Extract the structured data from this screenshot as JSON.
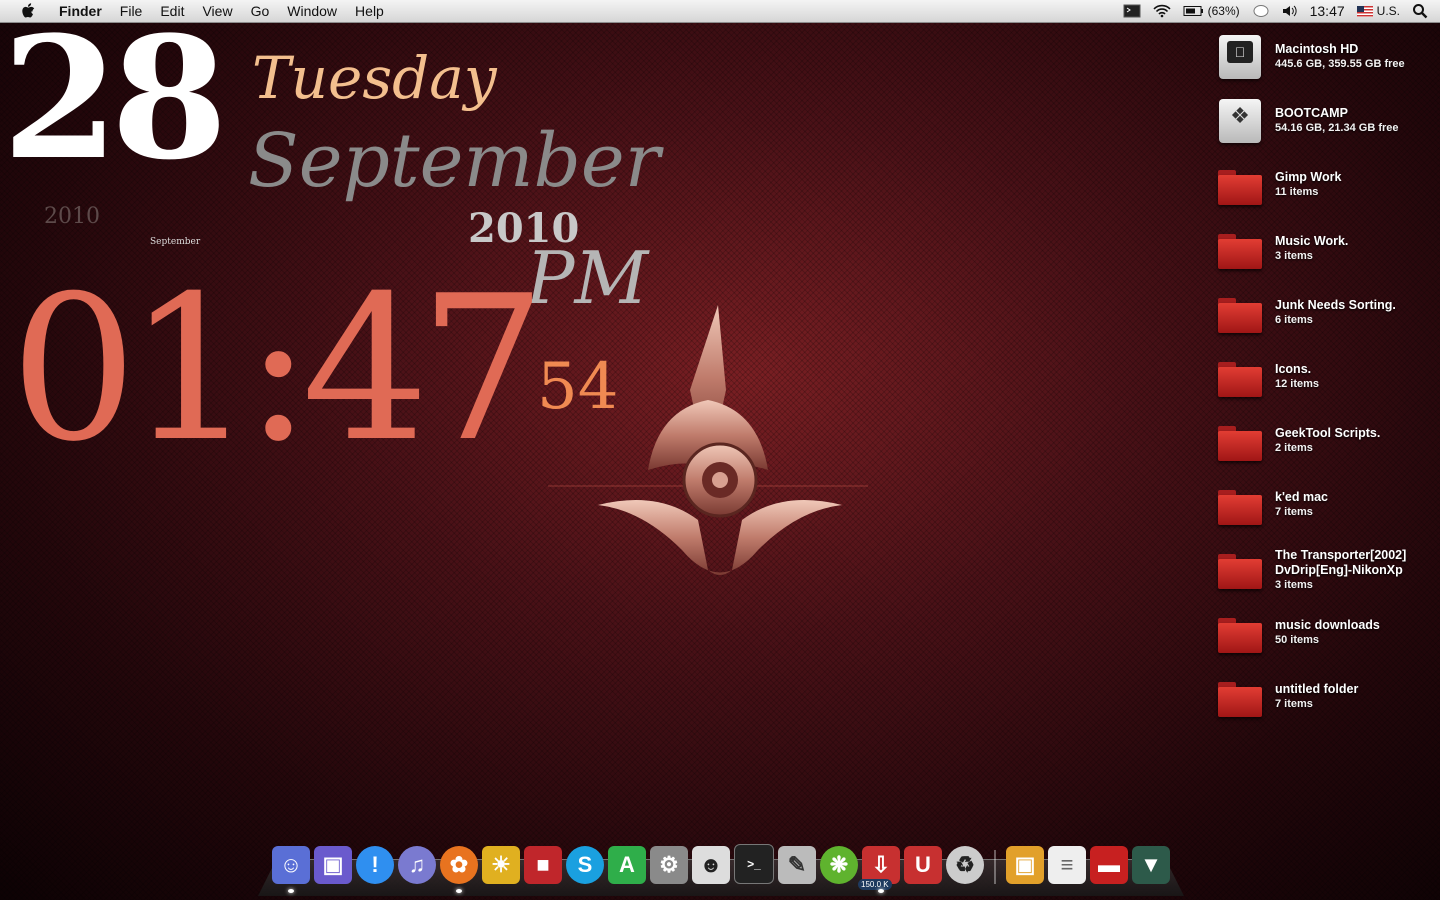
{
  "menubar": {
    "app": "Finder",
    "items": [
      "File",
      "Edit",
      "View",
      "Go",
      "Window",
      "Help"
    ],
    "battery": "(63%)",
    "clock": "13:47",
    "input_source": "U.S."
  },
  "clock_widget": {
    "day": "28",
    "weekday": "Tuesday",
    "month": "September",
    "year_small": "2010",
    "month_tiny": "September",
    "year": "2010",
    "ampm": "PM",
    "time": "01:47",
    "seconds": "54"
  },
  "desktop_icons": [
    {
      "name": "Macintosh HD",
      "sub": "445.6 GB, 359.55 GB free",
      "icon": "hard-drive-icon"
    },
    {
      "name": "BOOTCAMP",
      "sub": "54.16 GB, 21.34 GB free",
      "icon": "bootcamp-drive-icon"
    },
    {
      "name": "Gimp Work",
      "sub": "11 items",
      "icon": "folder-icon"
    },
    {
      "name": "Music Work.",
      "sub": "3 items",
      "icon": "folder-icon"
    },
    {
      "name": "Junk Needs Sorting.",
      "sub": "6 items",
      "icon": "folder-icon"
    },
    {
      "name": "Icons.",
      "sub": "12 items",
      "icon": "folder-icon"
    },
    {
      "name": "GeekTool Scripts.",
      "sub": "2 items",
      "icon": "folder-icon"
    },
    {
      "name": "k'ed mac",
      "sub": "7 items",
      "icon": "folder-icon"
    },
    {
      "name": "The Transporter[2002]\nDvDrip[Eng]-NikonXp",
      "sub": "3 items",
      "icon": "folder-icon"
    },
    {
      "name": "music downloads",
      "sub": "50 items",
      "icon": "folder-icon"
    },
    {
      "name": "untitled folder",
      "sub": "7 items",
      "icon": "folder-icon"
    }
  ],
  "dock": {
    "download_badge": "150.0 K",
    "apps": [
      {
        "icon": "finder-icon",
        "color": "#5a6fd6"
      },
      {
        "icon": "preview-icon",
        "color": "#6a5acd"
      },
      {
        "icon": "growl-icon",
        "color": "#2f8ff0"
      },
      {
        "icon": "itunes-icon",
        "color": "#7a7ad0"
      },
      {
        "icon": "firefox-icon",
        "color": "#e8731f"
      },
      {
        "icon": "iphoto-icon",
        "color": "#e0b020"
      },
      {
        "icon": "photo-booth-icon",
        "color": "#c0262b"
      },
      {
        "icon": "skype-icon",
        "color": "#1aa0e0"
      },
      {
        "icon": "app-store-icon",
        "color": "#2fae4a"
      },
      {
        "icon": "system-preferences-icon",
        "color": "#8a8a8a"
      },
      {
        "icon": "anonymous-mask-icon",
        "color": "#dddddd"
      },
      {
        "icon": "terminal-icon",
        "color": "#222222"
      },
      {
        "icon": "textedit-icon",
        "color": "#bbbbbb"
      },
      {
        "icon": "limewire-icon",
        "color": "#5fb32e"
      },
      {
        "icon": "transmission-icon",
        "color": "#c73030"
      },
      {
        "icon": "magnet-icon",
        "color": "#c73030"
      },
      {
        "icon": "trash-recycle-icon",
        "color": "#cccccc"
      }
    ],
    "stacks": [
      {
        "icon": "documents-stack-icon",
        "color": "#e2a02a"
      },
      {
        "icon": "text-file-icon",
        "color": "#eeeeee"
      },
      {
        "icon": "red-folder-icon",
        "color": "#c72020"
      },
      {
        "icon": "downloads-stack-icon",
        "color": "#2d5a4a"
      }
    ]
  }
}
